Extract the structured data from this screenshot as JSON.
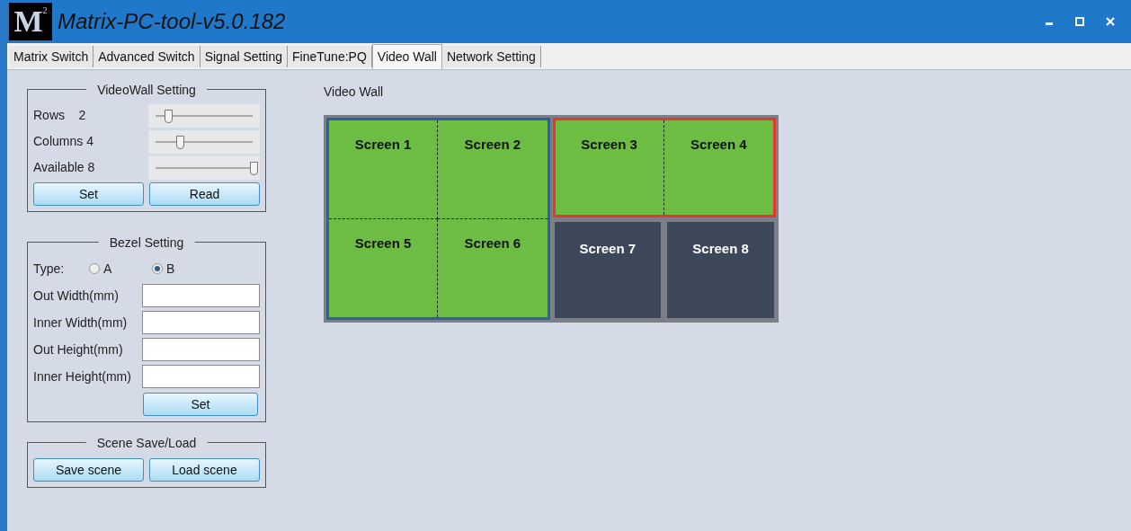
{
  "window": {
    "title": "Matrix-PC-tool-v5.0.182",
    "logo": "M",
    "logo_sup": "2"
  },
  "tabs": [
    {
      "label": "Matrix Switch",
      "selected": false
    },
    {
      "label": "Advanced Switch",
      "selected": false
    },
    {
      "label": "Signal Setting",
      "selected": false
    },
    {
      "label": "FineTune:PQ",
      "selected": false
    },
    {
      "label": "Video Wall",
      "selected": true
    },
    {
      "label": "Network Setting",
      "selected": false
    }
  ],
  "videowall_setting": {
    "title": "VideoWall Setting",
    "sliders": [
      {
        "label": "Rows",
        "value": "2",
        "level": 0.1
      },
      {
        "label": "Columns",
        "value": "4",
        "level": 0.22
      },
      {
        "label": "Available",
        "value": "8",
        "level": 1
      }
    ],
    "buttons": [
      "Set",
      "Read"
    ]
  },
  "bezel_setting": {
    "title": "Bezel Setting",
    "type_label": "Type:",
    "types": [
      {
        "label": "A",
        "selected": false
      },
      {
        "label": "B",
        "selected": true
      }
    ],
    "fields": [
      {
        "label": "Out Width(mm)"
      },
      {
        "label": "Inner Width(mm)"
      },
      {
        "label": "Out Height(mm)"
      },
      {
        "label": "Inner Height(mm)"
      }
    ],
    "button": "Set"
  },
  "scene": {
    "title": "Scene Save/Load",
    "buttons": [
      "Save scene",
      "Load scene"
    ]
  },
  "wall": {
    "title": "Video Wall",
    "groups": [
      {
        "color": "#2f5ea6",
        "rows": [
          [
            "Screen 1",
            "Screen 2"
          ],
          [
            "Screen 5",
            "Screen 6"
          ]
        ]
      },
      {
        "color": "#e8352e",
        "rows": [
          [
            "Screen 3",
            "Screen 4"
          ]
        ]
      }
    ],
    "screens": [
      {
        "label": "Screen 7"
      },
      {
        "label": "Screen 8"
      }
    ]
  }
}
